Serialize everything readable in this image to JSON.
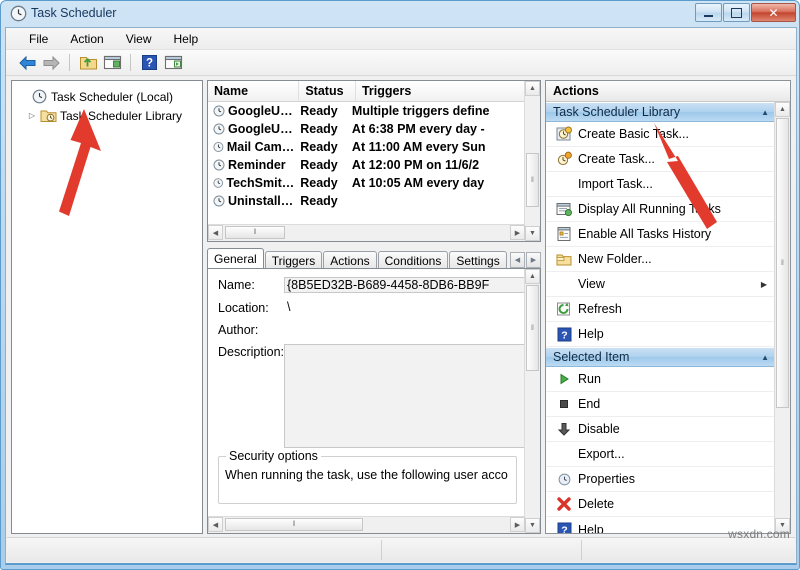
{
  "window": {
    "title": "Task Scheduler",
    "title_icon": "clock-icon",
    "buttons": {
      "minimize": "minimize-button",
      "maximize": "maximize-button",
      "close": "close-button",
      "close_glyph": "✕"
    }
  },
  "menubar": {
    "items": [
      {
        "label": "File"
      },
      {
        "label": "Action"
      },
      {
        "label": "View"
      },
      {
        "label": "Help"
      }
    ]
  },
  "toolbar": {
    "items": [
      {
        "name": "back-button",
        "icon": "back-arrow-icon"
      },
      {
        "name": "forward-button",
        "icon": "forward-arrow-icon"
      },
      {
        "name": "up-folder-button",
        "icon": "folder-up-icon"
      },
      {
        "name": "properties-button",
        "icon": "properties-pane-icon"
      },
      {
        "name": "help-button",
        "icon": "help-question-icon"
      },
      {
        "name": "show-action-pane-button",
        "icon": "action-pane-icon"
      }
    ]
  },
  "tree": {
    "nodes": [
      {
        "label": "Task Scheduler (Local)",
        "icon": "clock-icon",
        "expander": "",
        "level": 0
      },
      {
        "label": "Task Scheduler Library",
        "icon": "folder-clock-icon",
        "expander": "▷",
        "level": 1
      }
    ]
  },
  "task_list": {
    "columns": [
      {
        "label": "Name"
      },
      {
        "label": "Status"
      },
      {
        "label": "Triggers"
      }
    ],
    "rows": [
      {
        "name": "GoogleU…",
        "status": "Ready",
        "triggers": "Multiple triggers define",
        "icon": "clock-icon"
      },
      {
        "name": "GoogleU…",
        "status": "Ready",
        "triggers": "At 6:38 PM every day -",
        "icon": "clock-icon"
      },
      {
        "name": "Mail Cam…",
        "status": "Ready",
        "triggers": "At 11:00 AM every Sun",
        "icon": "clock-icon"
      },
      {
        "name": "Reminder",
        "status": "Ready",
        "triggers": "At 12:00 PM on 11/6/2",
        "icon": "clock-icon"
      },
      {
        "name": "TechSmit…",
        "status": "Ready",
        "triggers": "At 10:05 AM every day",
        "icon": "clock-icon"
      },
      {
        "name": "Uninstall…",
        "status": "Ready",
        "triggers": "",
        "icon": "clock-icon"
      }
    ],
    "scroll": {
      "up_arrow": "▲",
      "down_arrow": "▼",
      "left_arrow": "◀",
      "right_arrow": "▶",
      "grip": "‖"
    }
  },
  "details": {
    "tabs": [
      {
        "label": "General",
        "active": true
      },
      {
        "label": "Triggers",
        "active": false
      },
      {
        "label": "Actions",
        "active": false
      },
      {
        "label": "Conditions",
        "active": false
      },
      {
        "label": "Settings",
        "active": false
      }
    ],
    "tab_nav": {
      "prev": "◀",
      "next": "▶"
    },
    "fields": [
      {
        "label": "Name:",
        "value": "{8B5ED32B-B689-4458-8DB6-BB9F",
        "type": "textbox"
      },
      {
        "label": "Location:",
        "value": "\\",
        "type": "plain"
      },
      {
        "label": "Author:",
        "value": "",
        "type": "plain"
      },
      {
        "label": "Description:",
        "value": "",
        "type": "textarea"
      }
    ],
    "security_group": {
      "title": "Security options",
      "text": "When running the task, use the following user acco"
    }
  },
  "actions": {
    "header": "Actions",
    "groups": [
      {
        "title": "Task Scheduler Library",
        "collapse_glyph": "▲",
        "items": [
          {
            "label": "Create Basic Task...",
            "icon": "create-basic-task-icon"
          },
          {
            "label": "Create Task...",
            "icon": "create-task-icon"
          },
          {
            "label": "Import Task...",
            "icon": ""
          },
          {
            "label": "Display All Running Tasks",
            "icon": "running-tasks-icon"
          },
          {
            "label": "Enable All Tasks History",
            "icon": "history-icon"
          },
          {
            "label": "New Folder...",
            "icon": "new-folder-icon"
          },
          {
            "label": "View",
            "icon": "",
            "submenu": "▶"
          },
          {
            "label": "Refresh",
            "icon": "refresh-icon"
          },
          {
            "label": "Help",
            "icon": "help-question-icon"
          }
        ]
      },
      {
        "title": "Selected Item",
        "collapse_glyph": "▲",
        "items": [
          {
            "label": "Run",
            "icon": "run-play-icon"
          },
          {
            "label": "End",
            "icon": "stop-square-icon"
          },
          {
            "label": "Disable",
            "icon": "disable-down-arrow-icon"
          },
          {
            "label": "Export...",
            "icon": ""
          },
          {
            "label": "Properties",
            "icon": "clock-icon"
          },
          {
            "label": "Delete",
            "icon": "delete-x-icon"
          },
          {
            "label": "Help",
            "icon": "help-question-icon"
          }
        ]
      }
    ]
  },
  "annotations": {
    "arrow_color": "#e23b2e",
    "arrows": [
      {
        "name": "tree-library-arrow",
        "points_to": "Task Scheduler Library"
      },
      {
        "name": "create-basic-task-arrow",
        "points_to": "Create Basic Task..."
      }
    ]
  },
  "watermark": {
    "text": "wsxdn.com"
  },
  "colors": {
    "frame": "#5c9ccc",
    "title_text": "#17365d",
    "group_header": "#aed2ef",
    "accent_red": "#e23b2e"
  }
}
